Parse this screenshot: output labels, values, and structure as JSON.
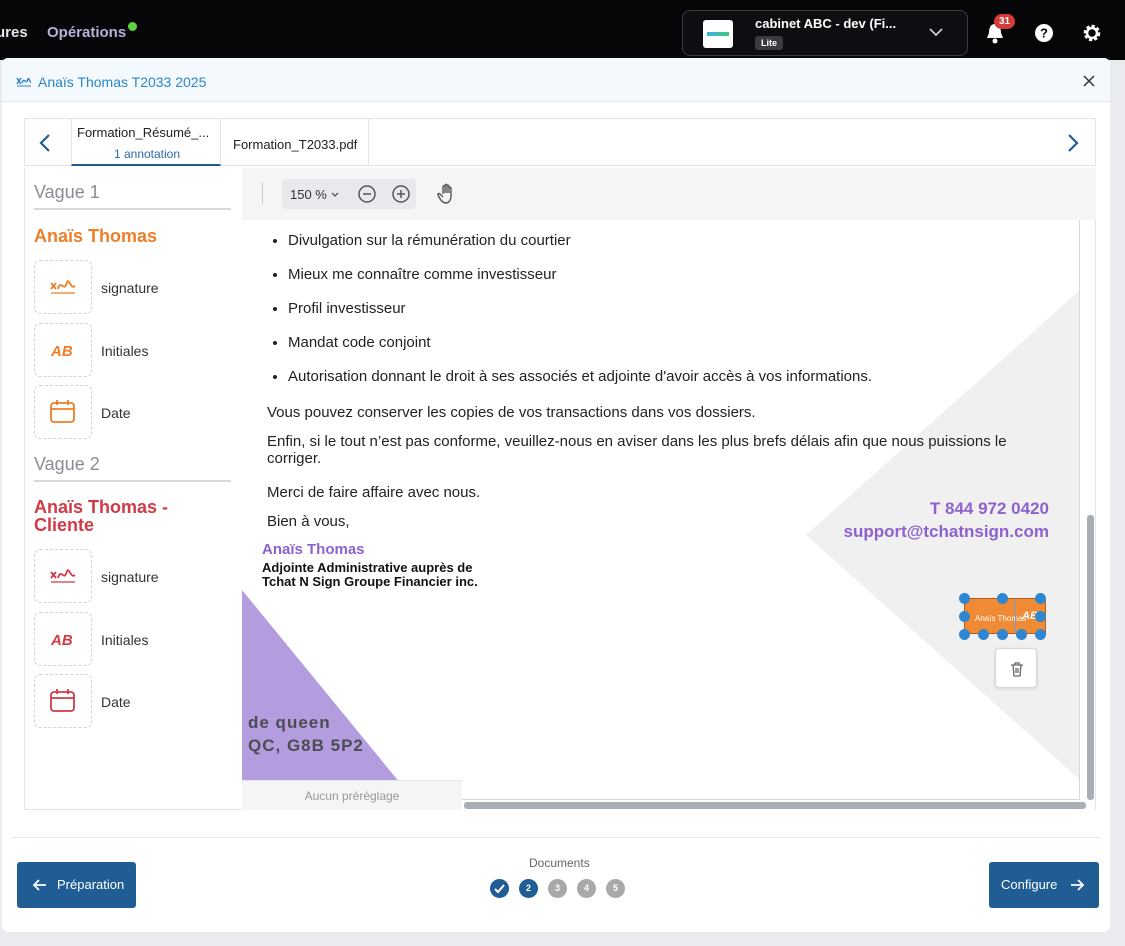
{
  "topbar": {
    "nav_left": "ures",
    "nav_operations": "Opérations",
    "company_name": "cabinet ABC - dev (Fi...",
    "company_plan": "Lite",
    "notifications_count": "31"
  },
  "modal": {
    "title": "Anaïs Thomas T2033 2025"
  },
  "tabs": [
    {
      "label": "Formation_Résumé_...",
      "sub": "1 annotation"
    },
    {
      "label": "Formation_T2033.pdf"
    }
  ],
  "panel": {
    "waves": [
      {
        "title": "Vague 1",
        "signer": "Anaïs Thomas",
        "color": "#ee7e27",
        "fields": [
          "signature",
          "Initiales",
          "Date"
        ]
      },
      {
        "title": "Vague 2",
        "signer": "Anaïs Thomas - Cliente",
        "color": "#d13a46",
        "fields": [
          "signature",
          "Initiales",
          "Date"
        ]
      }
    ]
  },
  "viewer": {
    "zoom": "150 %",
    "preset": "Aucun préréglage"
  },
  "document": {
    "bullets": [
      "Divulgation sur la rémunération du courtier",
      "Mieux me connaître comme investisseur",
      "Profil investisseur",
      "Mandat code conjoint",
      "Autorisation donnant le droit à ses associés et adjointe d'avoir accès à vos informations."
    ],
    "para_copies": "Vous pouvez conserver les copies de vos transactions dans vos dossiers.",
    "para_conform": "Enfin, si le tout n’est pas conforme, veuillez-nous en aviser dans les plus brefs délais afin que nous puissions le corriger.",
    "para_merci": "Merci de faire affaire avec nous.",
    "closing": "Bien à vous,",
    "phone": "T 844 972 0420",
    "email": "support@tchatnsign.com",
    "sig_name": "Anaïs Thomas",
    "sig_title_1": "Adjointe Administrative auprès de",
    "sig_title_2": "Tchat N Sign Groupe Financier inc.",
    "address_1": "de queen",
    "address_2": "QC, G8B 5P2",
    "annotation_text": "Anaïs Thomas"
  },
  "footer": {
    "prev_label": "Préparation",
    "next_label": "Configure",
    "docs_label": "Documents",
    "steps": [
      "2",
      "3",
      "4",
      "5"
    ]
  },
  "colors": {
    "primary": "#1f5d94",
    "accent_purple": "#8d62cf",
    "orange": "#ee7e27",
    "red": "#d13a46"
  }
}
